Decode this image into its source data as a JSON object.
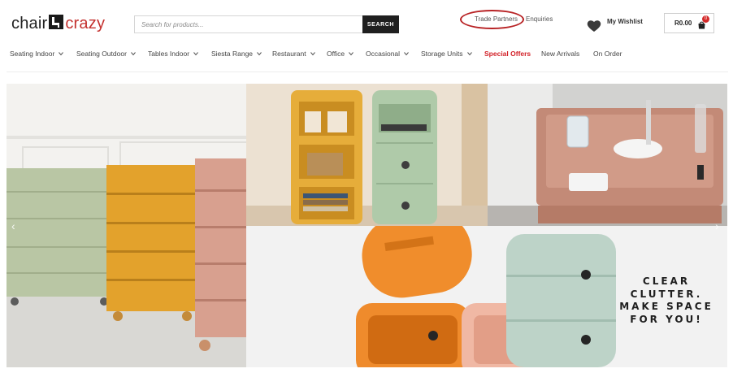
{
  "logo": {
    "part1": "chair",
    "part2": "crazy"
  },
  "search": {
    "placeholder": "Search for products...",
    "button_label": "SEARCH"
  },
  "top_links": {
    "trade_partners": "Trade Partners",
    "enquiries": "Enquiries"
  },
  "wishlist": {
    "label": "My Wishlist",
    "icon": "heart-icon"
  },
  "cart": {
    "total": "R0.00",
    "count": "0",
    "icon": "shopping-bag-icon"
  },
  "nav": {
    "items": [
      {
        "label": "Seating Indoor",
        "dropdown": true
      },
      {
        "label": "Seating Outdoor",
        "dropdown": true
      },
      {
        "label": "Tables Indoor",
        "dropdown": true
      },
      {
        "label": "Siesta Range",
        "dropdown": true
      },
      {
        "label": "Restaurant",
        "dropdown": true
      },
      {
        "label": "Office",
        "dropdown": true
      },
      {
        "label": "Occasional",
        "dropdown": true
      },
      {
        "label": "Storage Units",
        "dropdown": true
      },
      {
        "label": "Special Offers",
        "dropdown": false
      },
      {
        "label": "New Arrivals",
        "dropdown": false
      },
      {
        "label": "On Order",
        "dropdown": false
      }
    ]
  },
  "hero": {
    "arrow_prev": "‹",
    "arrow_next": "›",
    "tagline": [
      "CLEAR",
      "CLUTTER.",
      "MAKE SPACE",
      "FOR YOU!"
    ]
  },
  "colors": {
    "brand_red": "#c4312f",
    "special_red": "#d21f26",
    "dark": "#1f1f1f"
  }
}
